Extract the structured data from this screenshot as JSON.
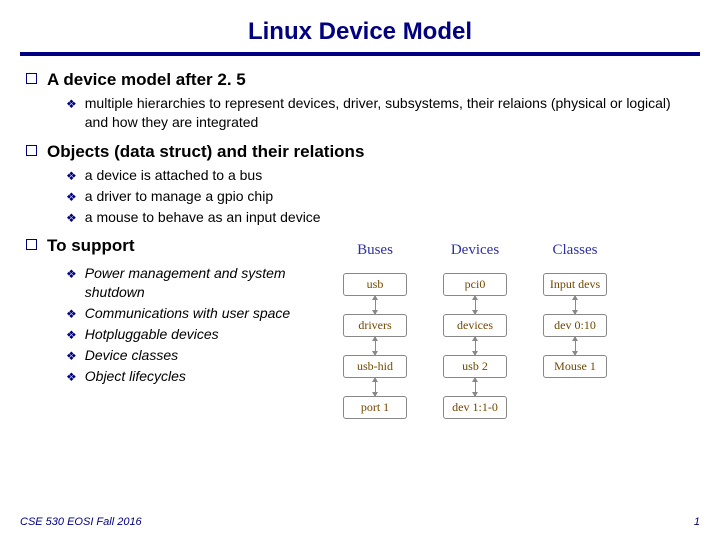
{
  "title": "Linux Device Model",
  "sections": [
    {
      "heading": "A device model after 2. 5",
      "items": [
        {
          "text": "multiple hierarchies to represent devices, driver, subsystems, their relaions (physical or logical) and how they are integrated",
          "italic": false
        }
      ]
    },
    {
      "heading": "Objects (data struct) and their relations",
      "items": [
        {
          "text": "a device is attached to a bus",
          "italic": false
        },
        {
          "text": "a driver to manage a gpio chip",
          "italic": false
        },
        {
          "text": "a mouse to behave as an input device",
          "italic": false
        }
      ]
    },
    {
      "heading": "To support",
      "items": [
        {
          "text": "Power management and system shutdown",
          "italic": true
        },
        {
          "text": "Communications with user space",
          "italic": true
        },
        {
          "text": "Hotpluggable devices",
          "italic": true
        },
        {
          "text": "Device classes",
          "italic": true
        },
        {
          "text": "Object lifecycles",
          "italic": true
        }
      ]
    }
  ],
  "diagram": {
    "columns": [
      {
        "header": "Buses",
        "nodes": [
          "usb",
          "drivers",
          "usb-hid",
          "port 1"
        ]
      },
      {
        "header": "Devices",
        "nodes": [
          "pci0",
          "devices",
          "usb 2",
          "dev 1:1-0"
        ]
      },
      {
        "header": "Classes",
        "nodes": [
          "Input devs",
          "dev 0:10",
          "Mouse 1"
        ]
      }
    ]
  },
  "footer": {
    "left": "CSE 530 EOSI Fall 2016",
    "right": "1"
  }
}
